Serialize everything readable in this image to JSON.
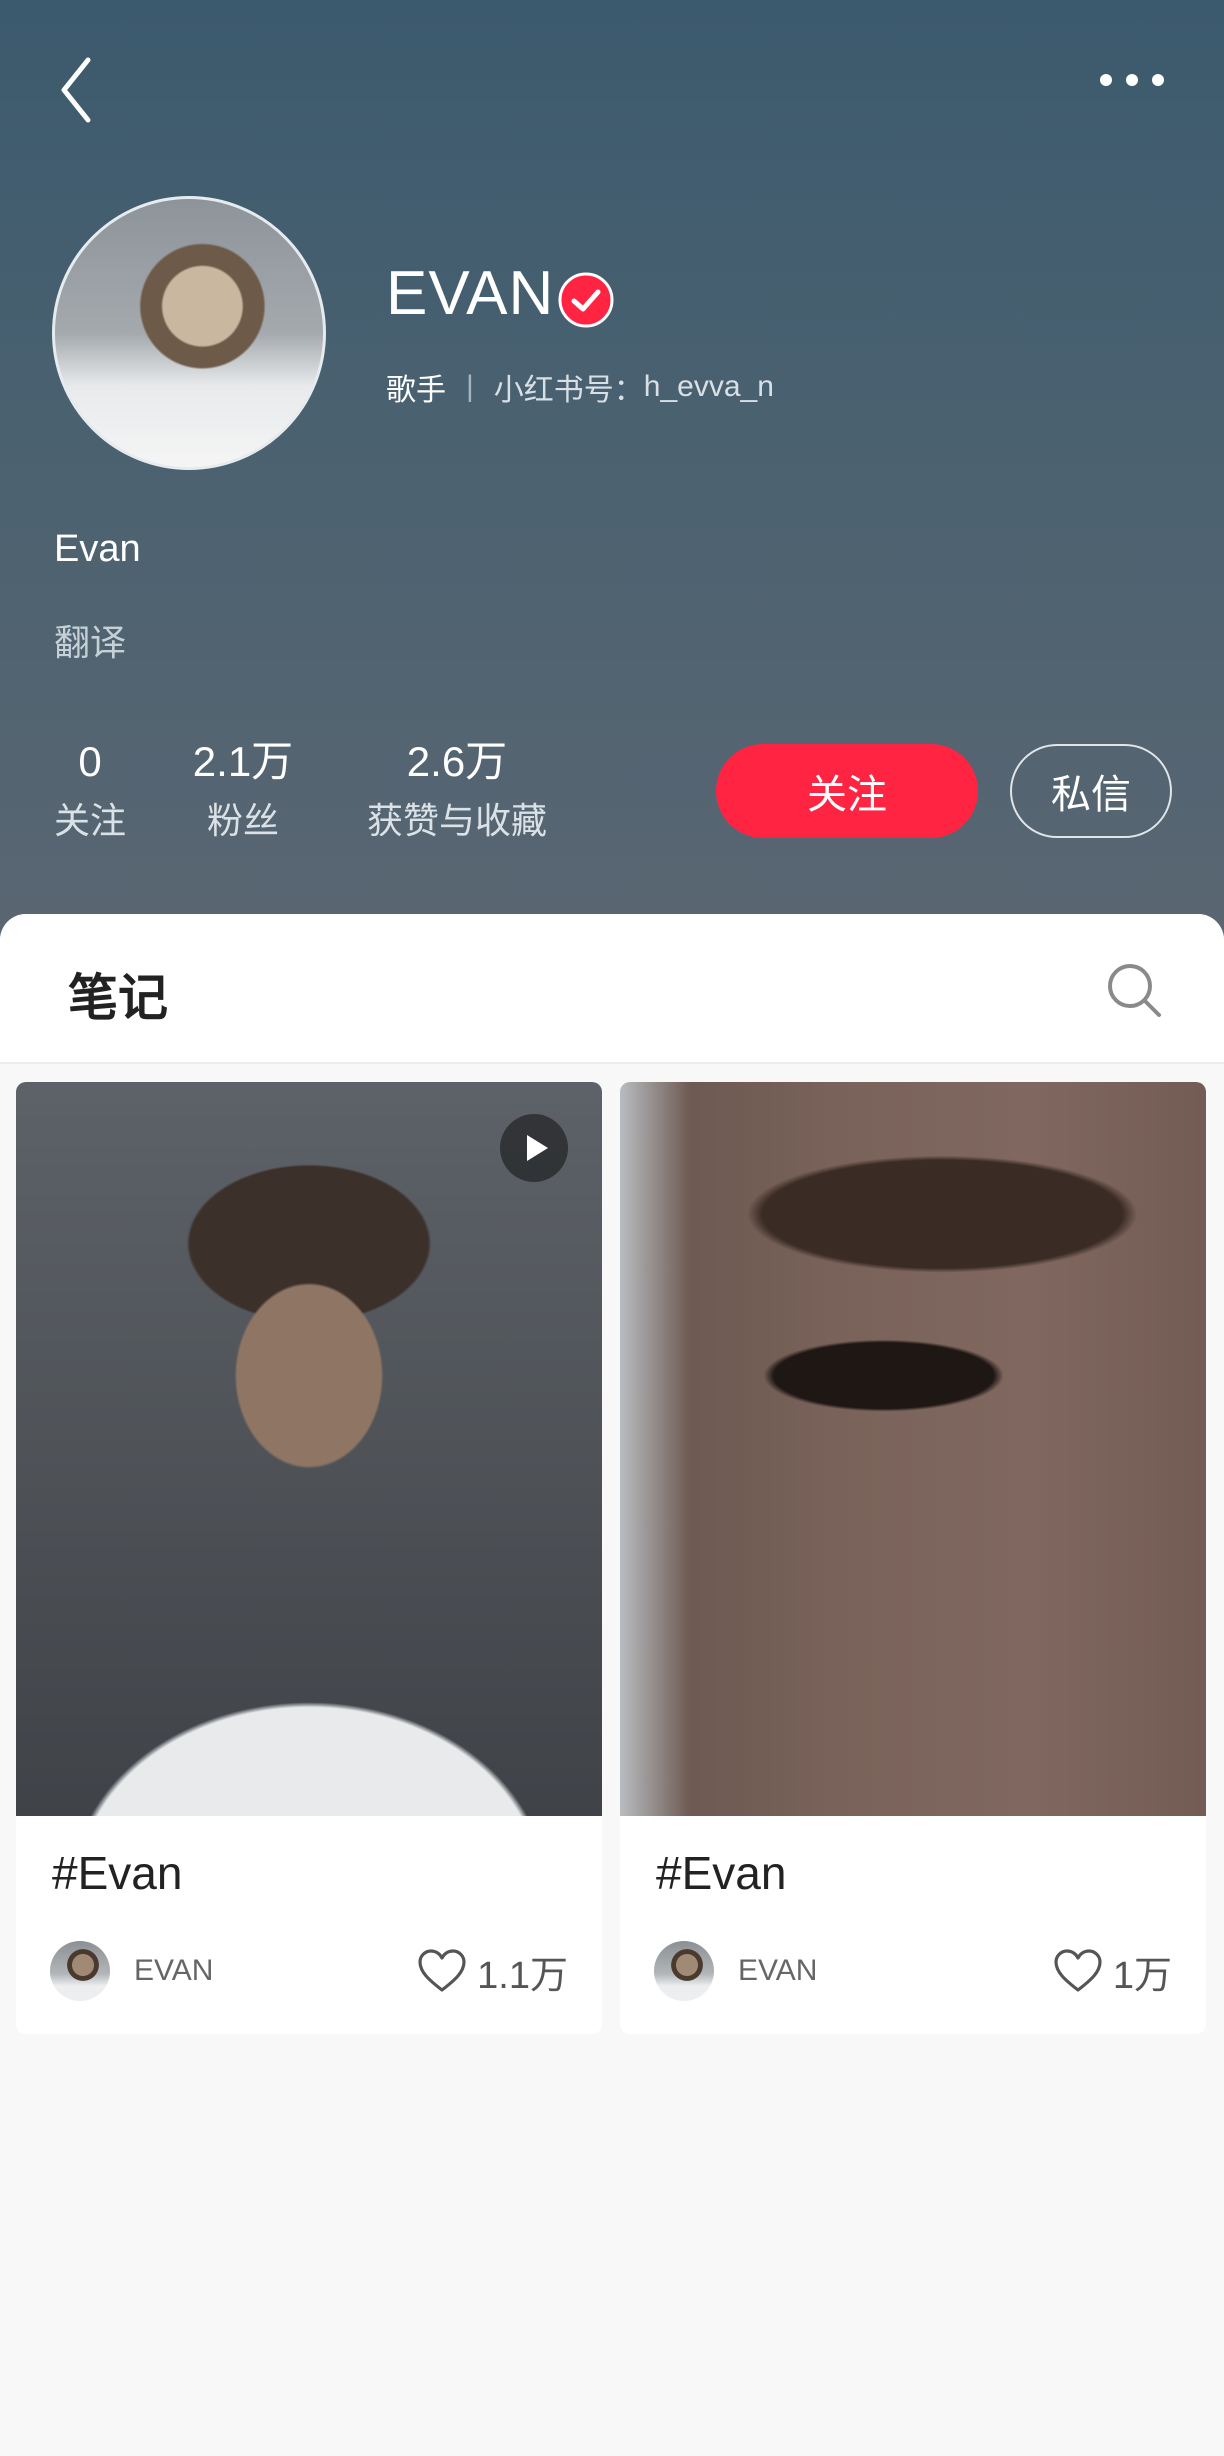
{
  "profile": {
    "username": "EVAN",
    "role": "歌手",
    "id_label": "小红书号：",
    "id_value": "h_evva_n",
    "bio_name": "Evan",
    "bio_translate": "翻译"
  },
  "stats": [
    {
      "num": "0",
      "label": "关注"
    },
    {
      "num": "2.1万",
      "label": "粉丝"
    },
    {
      "num": "2.6万",
      "label": "获赞与收藏"
    }
  ],
  "buttons": {
    "follow": "关注",
    "message": "私信"
  },
  "tabs": {
    "notes": "笔记"
  },
  "notes": [
    {
      "title": "#Evan",
      "author": "EVAN",
      "likes": "1.1万",
      "is_video": true
    },
    {
      "title": "#Evan",
      "author": "EVAN",
      "likes": "1万",
      "is_video": false
    }
  ],
  "icons": {
    "back": "chevron-left-icon",
    "more": "more-dots-icon",
    "verified": "verified-badge-icon",
    "search": "search-icon",
    "play": "play-icon",
    "heart": "heart-icon"
  },
  "colors": {
    "accent": "#ff2442",
    "header": "#4a6170"
  }
}
